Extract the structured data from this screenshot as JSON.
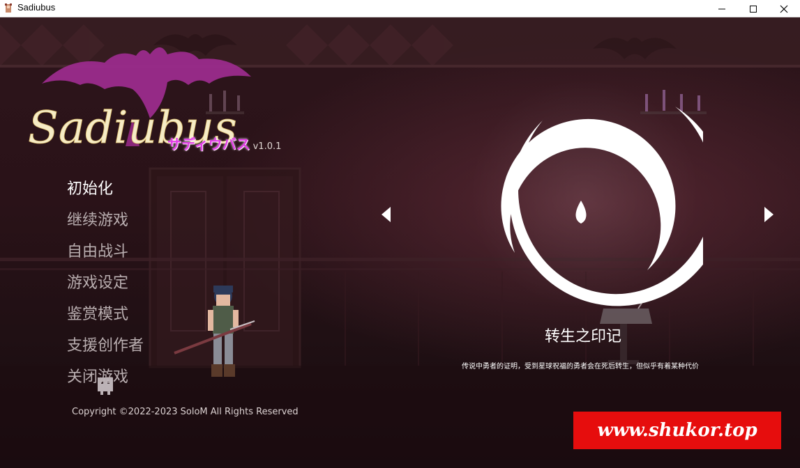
{
  "window": {
    "title": "Sadiubus",
    "controls": {
      "minimize": "minimize-icon",
      "maximize": "maximize-icon",
      "close": "close-icon"
    }
  },
  "logo": {
    "title": "Sadiubus",
    "subtitle": "サディウバス",
    "version": "v1.0.1",
    "wing_color": "#9b2b8c",
    "subtitle_color": "#e23ee6"
  },
  "menu": {
    "items": [
      {
        "label": "初始化",
        "selected": true
      },
      {
        "label": "继续游戏",
        "selected": false
      },
      {
        "label": "自由战斗",
        "selected": false
      },
      {
        "label": "游戏设定",
        "selected": false
      },
      {
        "label": "鉴赏模式",
        "selected": false
      },
      {
        "label": "支援创作者",
        "selected": false
      },
      {
        "label": "关闭游戏",
        "selected": false
      }
    ]
  },
  "copyright": "Copyright ©2022-2023 SoloM All Rights Reserved",
  "seal_selector": {
    "name": "转生之印记",
    "description": "传说中勇者的证明，受到星球祝福的勇者会在死后转生，但似乎有着某种代价",
    "prev_icon": "triangle-left-icon",
    "next_icon": "triangle-right-icon",
    "emblem_icon": "spiral-seal-icon"
  },
  "watermark": {
    "text": "www.shukor.top",
    "background": "#e60d0d"
  }
}
